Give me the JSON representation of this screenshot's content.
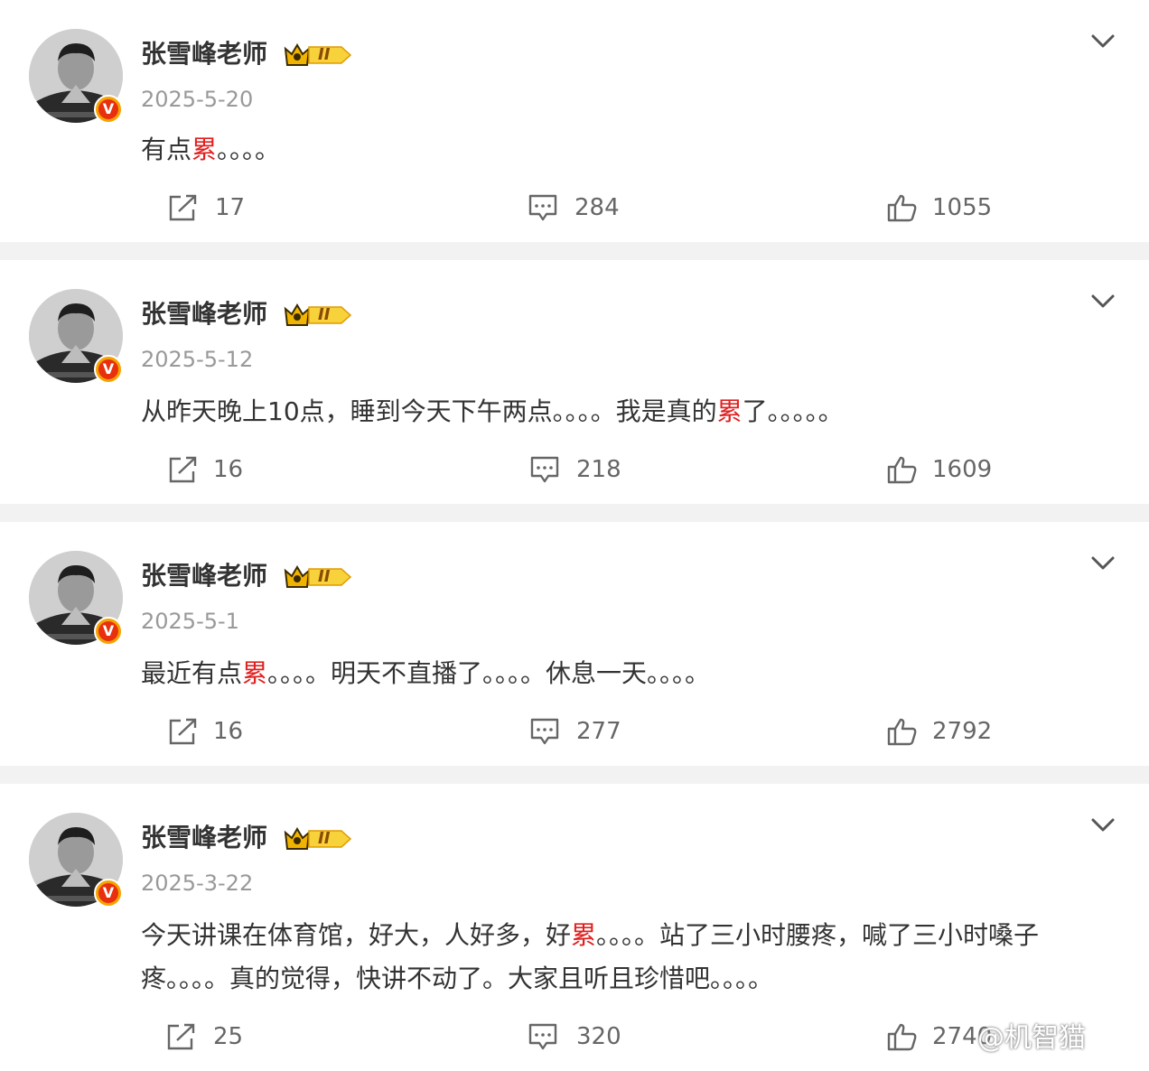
{
  "posts": [
    {
      "author": "张雪峰老师",
      "badge_level": "II",
      "date": "2025-5-20",
      "text_parts": [
        "有点",
        "累",
        "。。。。",
        "",
        "",
        ""
      ],
      "reposts": "17",
      "comments": "284",
      "likes": "1055"
    },
    {
      "author": "张雪峰老师",
      "badge_level": "II",
      "date": "2025-5-12",
      "text_parts": [
        "从昨天晚上10点，睡到今天下午两点。。。。我是真的",
        "累",
        "了。。。。。",
        "",
        "",
        ""
      ],
      "reposts": "16",
      "comments": "218",
      "likes": "1609"
    },
    {
      "author": "张雪峰老师",
      "badge_level": "II",
      "date": "2025-5-1",
      "text_parts": [
        "最近有点",
        "累",
        "。。。。明天不直播了。。。。休息一天。。。。",
        "",
        "",
        ""
      ],
      "reposts": "16",
      "comments": "277",
      "likes": "2792"
    },
    {
      "author": "张雪峰老师",
      "badge_level": "II",
      "date": "2025-3-22",
      "text_parts": [
        "今天讲课在体育馆，好大，人好多，好",
        "累",
        "。。。。站了三小时腰疼，喊了三小时嗓子",
        "疼。。。。真的觉得，快讲不动了。大家且听且珍惜吧。。。。",
        "",
        ""
      ],
      "reposts": "25",
      "comments": "320",
      "likes": "2740"
    }
  ],
  "icons": {
    "repost": "repost-icon",
    "comment": "comment-icon",
    "like": "thumbs-up-icon",
    "menu": "chevron-down-icon",
    "verified": "verified-v-badge-icon",
    "crown": "crown-badge-icon"
  },
  "colors": {
    "highlight": "#e02020",
    "divider": "#f2f2f2",
    "verified_orange": "#f5a300"
  },
  "watermark": "@机智猫"
}
